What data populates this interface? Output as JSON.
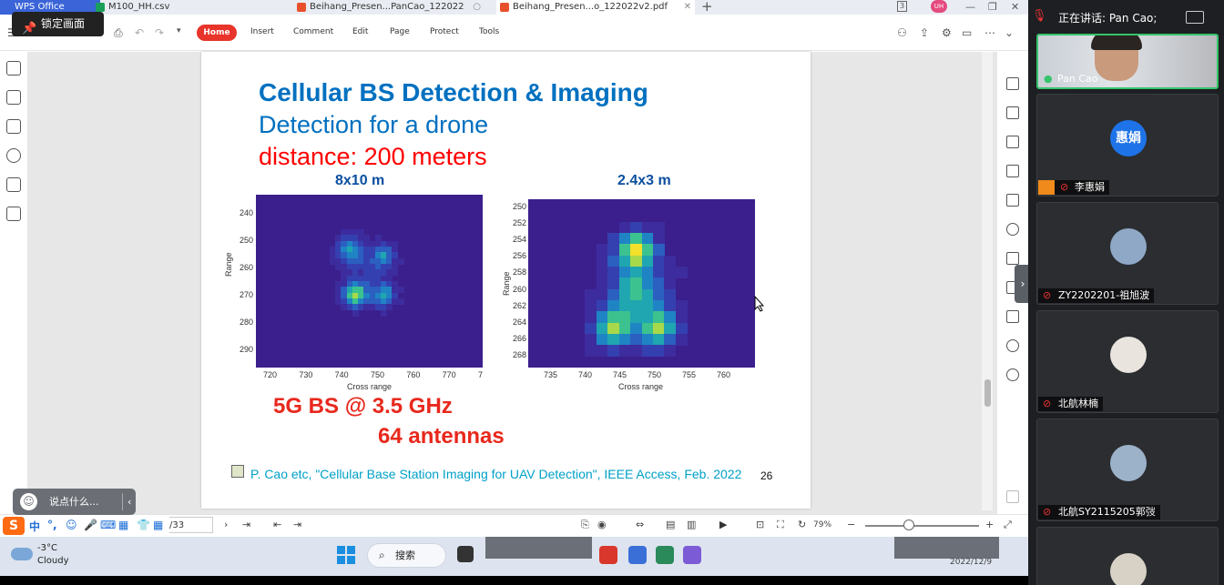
{
  "tabs": {
    "wps": "WPS Office",
    "csv": "M100_HH.csv",
    "pdf1": "Beihang_Presen...PanCao_122022",
    "pdf2": "Beihang_Presen...o_122022v2.pdf",
    "plus": "+"
  },
  "tab_right": {
    "counter": "3",
    "user_initials": "UH"
  },
  "lock_tooltip": "锁定画面",
  "toolbar": {
    "home": "Home",
    "menus": [
      "Insert",
      "Comment",
      "Edit",
      "Page",
      "Protect",
      "Tools"
    ]
  },
  "slide": {
    "title": "Cellular BS Detection & Imaging",
    "subtitle": "Detection for a drone",
    "distance": "distance: 200 meters",
    "left_plot_title": "8x10 m",
    "right_plot_title": "2.4x3 m",
    "bs_line1": "5G BS @ 3.5 GHz",
    "bs_line2": "64 antennas",
    "citation": "P. Cao etc, \"Cellular Base Station Imaging for UAV Detection\", IEEE Access, Feb. 2022",
    "page_number": "26"
  },
  "chart_data": [
    {
      "type": "heatmap",
      "title": "8x10 m",
      "xlabel": "Cross range",
      "ylabel": "Range",
      "x_ticks": [
        "720",
        "730",
        "740",
        "750",
        "760",
        "770",
        "7"
      ],
      "y_ticks": [
        "240",
        "250",
        "260",
        "270",
        "280",
        "290"
      ]
    },
    {
      "type": "heatmap",
      "title": "2.4x3 m",
      "xlabel": "Cross range",
      "ylabel": "Range",
      "x_ticks": [
        "735",
        "740",
        "745",
        "750",
        "755",
        "760"
      ],
      "y_ticks": [
        "250",
        "252",
        "254",
        "256",
        "258",
        "260",
        "262",
        "264",
        "266",
        "268"
      ]
    }
  ],
  "statusbar": {
    "page_total": "/33",
    "zoom": "79%"
  },
  "ime": {
    "hint": "说点什么...",
    "lang": "中"
  },
  "taskbar": {
    "temp": "-3°C",
    "condition": "Cloudy",
    "search": "搜索",
    "date": "2022/12/9"
  },
  "meeting": {
    "speaking": "正在讲话: Pan Cao;",
    "participants": [
      {
        "name": "Pan Cao"
      },
      {
        "name": "李惠娟",
        "avatar_text": "惠娟"
      },
      {
        "name": "ZY2202201-祖旭波"
      },
      {
        "name": "北航林楠"
      },
      {
        "name": "北航SY2115205郭弢"
      }
    ]
  },
  "colors": {
    "accent": "#e8342b",
    "title_blue": "#0070c0",
    "red_text": "#ff0000",
    "bs_red": "#e8281c",
    "cite_cyan": "#00a0c8"
  }
}
